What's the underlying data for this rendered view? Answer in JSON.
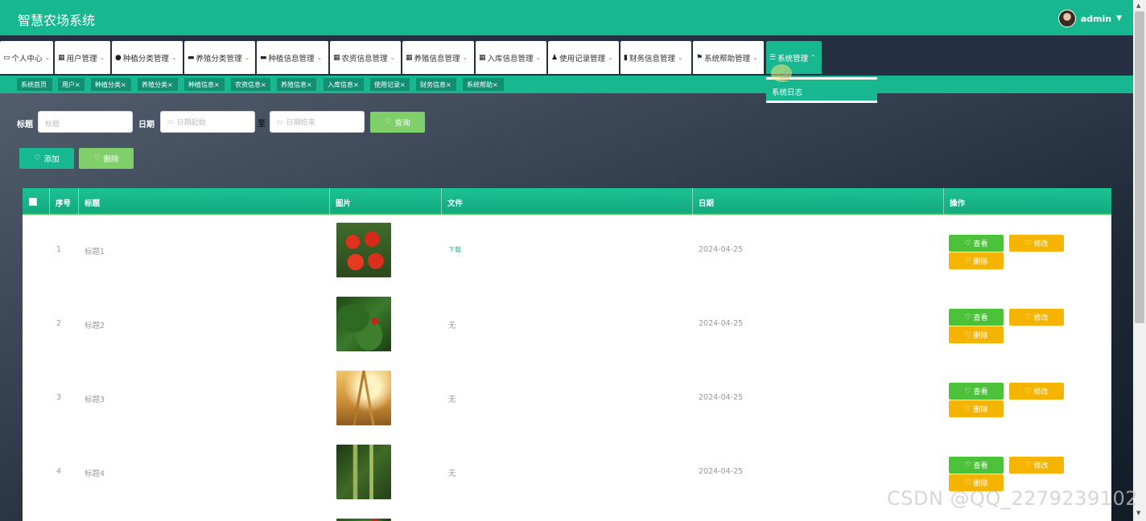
{
  "app": {
    "title": "智慧农场系统",
    "user": "admin",
    "caret": "▼"
  },
  "menu": [
    {
      "label": "个人中心",
      "icon": "id-card-icon",
      "glyph": "▭"
    },
    {
      "label": "用户管理",
      "icon": "grid-icon",
      "glyph": "▦"
    },
    {
      "label": "种植分类管理",
      "icon": "map-pin-icon",
      "glyph": "●"
    },
    {
      "label": "养殖分类管理",
      "icon": "comment-icon",
      "glyph": "▬"
    },
    {
      "label": "种植信息管理",
      "icon": "monitor-icon",
      "glyph": "▬"
    },
    {
      "label": "农资信息管理",
      "icon": "grid-icon",
      "glyph": "▦"
    },
    {
      "label": "养殖信息管理",
      "icon": "grid-icon",
      "glyph": "▦"
    },
    {
      "label": "入库信息管理",
      "icon": "grid-icon",
      "glyph": "▦"
    },
    {
      "label": "使用记录管理",
      "icon": "user-icon",
      "glyph": "♟"
    },
    {
      "label": "财务信息管理",
      "icon": "ledger-icon",
      "glyph": "▮"
    },
    {
      "label": "系统帮助管理",
      "icon": "flag-icon",
      "glyph": "⚑"
    },
    {
      "label": "系统管理",
      "icon": "list-icon",
      "glyph": "☰"
    }
  ],
  "dropdown": {
    "item": "系统日志"
  },
  "tabs": [
    "系统首页",
    "用户",
    "种植分类",
    "养殖分类",
    "种植信息",
    "农资信息",
    "养殖信息",
    "入库信息",
    "使用记录",
    "财务信息",
    "系统帮助"
  ],
  "search": {
    "title_label": "标题",
    "title_placeholder": "标题",
    "date_label": "日期",
    "date_start_placeholder": "日期起始",
    "date_to": "至",
    "date_end_placeholder": "日期结束",
    "query_button": "查询"
  },
  "actions": {
    "add": "添加",
    "delete": "删除"
  },
  "table": {
    "headers": [
      "序号",
      "标题",
      "图片",
      "文件",
      "日期",
      "操作"
    ],
    "rows": [
      {
        "index": "1",
        "title": "标题1",
        "image": "tomato",
        "file": "下载",
        "date": "2024-04-25"
      },
      {
        "index": "2",
        "title": "标题2",
        "image": "pepper",
        "file": "无",
        "date": "2024-04-25"
      },
      {
        "index": "3",
        "title": "标题3",
        "image": "wheat",
        "file": "无",
        "date": "2024-04-25"
      },
      {
        "index": "4",
        "title": "标题4",
        "image": "millet",
        "file": "无",
        "date": "2024-04-25"
      }
    ],
    "row_actions": {
      "view": "查看",
      "edit": "修改",
      "delete": "删除"
    }
  },
  "watermark": "CSDN @QQ_2279239102",
  "colors": {
    "primary": "#17b890",
    "tab_dark": "#128f72",
    "view_green": "#4cc23a",
    "edit_yellow": "#f5b400",
    "light_green": "#7fcf6b"
  }
}
